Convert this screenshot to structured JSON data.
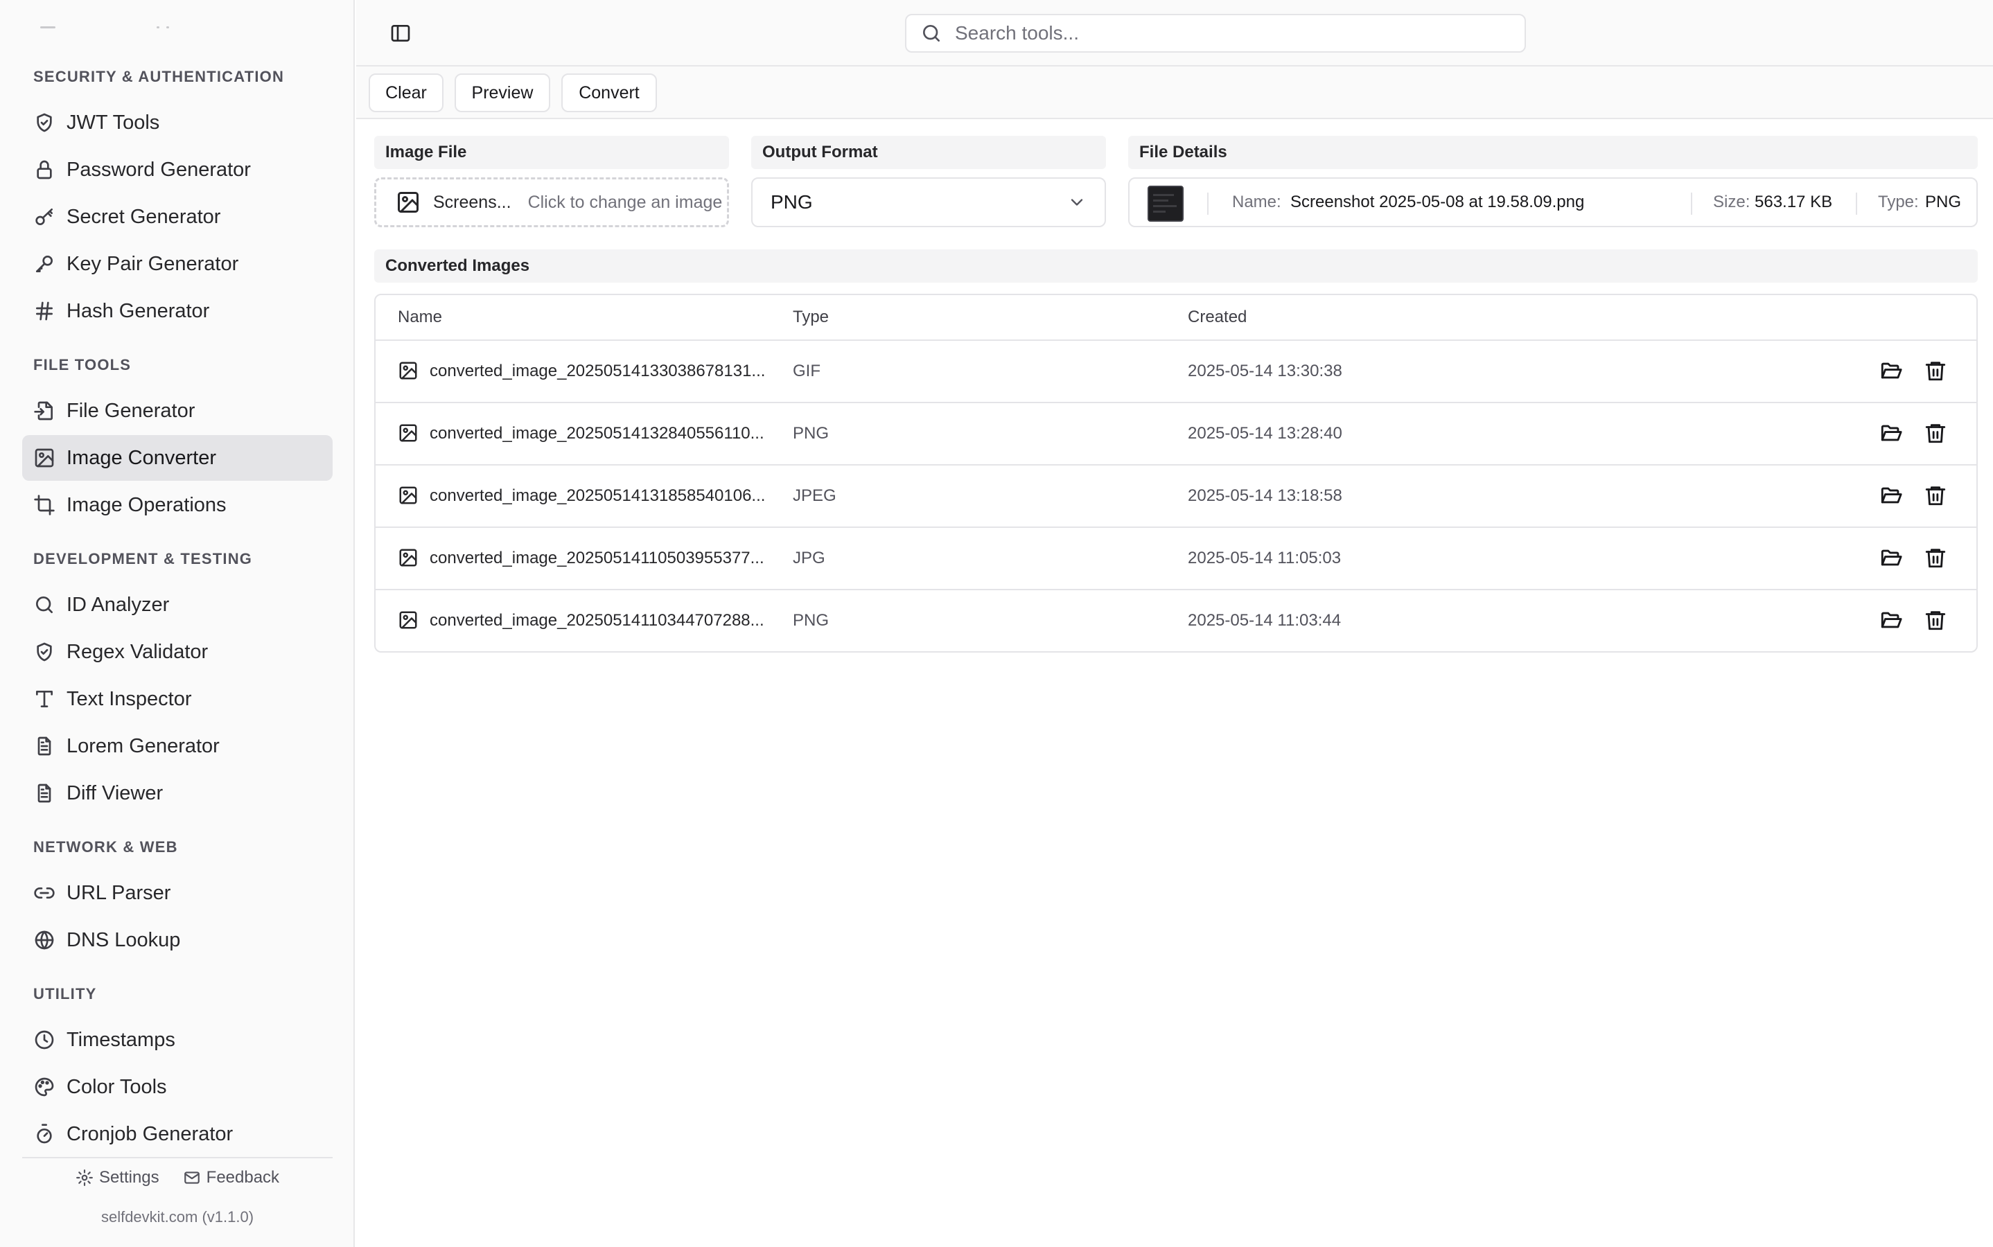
{
  "sidebar": {
    "sections": [
      {
        "title": "SECURITY & AUTHENTICATION",
        "items": [
          {
            "label": "JWT Tools",
            "icon": "shield-check-icon"
          },
          {
            "label": "Password Generator",
            "icon": "lock-icon"
          },
          {
            "label": "Secret Generator",
            "icon": "key-round-icon"
          },
          {
            "label": "Key Pair Generator",
            "icon": "key-icon"
          },
          {
            "label": "Hash Generator",
            "icon": "hash-icon"
          }
        ]
      },
      {
        "title": "FILE TOOLS",
        "items": [
          {
            "label": "File Generator",
            "icon": "file-input-icon"
          },
          {
            "label": "Image Converter",
            "icon": "image-icon",
            "active": true
          },
          {
            "label": "Image Operations",
            "icon": "crop-icon"
          }
        ]
      },
      {
        "title": "DEVELOPMENT & TESTING",
        "items": [
          {
            "label": "ID Analyzer",
            "icon": "search-icon"
          },
          {
            "label": "Regex Validator",
            "icon": "shield-check-icon"
          },
          {
            "label": "Text Inspector",
            "icon": "type-icon"
          },
          {
            "label": "Lorem Generator",
            "icon": "file-text-icon"
          },
          {
            "label": "Diff Viewer",
            "icon": "file-text-icon"
          }
        ]
      },
      {
        "title": "NETWORK & WEB",
        "items": [
          {
            "label": "URL Parser",
            "icon": "link-icon"
          },
          {
            "label": "DNS Lookup",
            "icon": "globe-icon"
          }
        ]
      },
      {
        "title": "UTILITY",
        "items": [
          {
            "label": "Timestamps",
            "icon": "clock-icon"
          },
          {
            "label": "Color Tools",
            "icon": "palette-icon"
          },
          {
            "label": "Cronjob Generator",
            "icon": "timer-icon"
          }
        ]
      }
    ],
    "footer": {
      "settings_label": "Settings",
      "feedback_label": "Feedback",
      "version": "selfdevkit.com (v1.1.0)"
    }
  },
  "search": {
    "placeholder": "Search tools..."
  },
  "toolbar": {
    "clear_label": "Clear",
    "preview_label": "Preview",
    "convert_label": "Convert"
  },
  "image_file": {
    "label": "Image File",
    "name": "Screens...",
    "hint": "Click to change an image"
  },
  "output_format": {
    "label": "Output Format",
    "value": "PNG"
  },
  "file_details": {
    "label": "File Details",
    "name_key": "Name:",
    "name": "Screenshot 2025-05-08 at 19.58.09.png",
    "size_key": "Size:",
    "size": "563.17 KB",
    "type_key": "Type:",
    "type": "PNG"
  },
  "converted": {
    "title": "Converted Images",
    "columns": [
      "Name",
      "Type",
      "Created"
    ],
    "rows": [
      {
        "name": "converted_image_20250514133038678131...",
        "type": "GIF",
        "created": "2025-05-14 13:30:38"
      },
      {
        "name": "converted_image_20250514132840556110...",
        "type": "PNG",
        "created": "2025-05-14 13:28:40"
      },
      {
        "name": "converted_image_20250514131858540106...",
        "type": "JPEG",
        "created": "2025-05-14 13:18:58"
      },
      {
        "name": "converted_image_20250514110503955377...",
        "type": "JPG",
        "created": "2025-05-14 11:05:03"
      },
      {
        "name": "converted_image_20250514110344707288...",
        "type": "PNG",
        "created": "2025-05-14 11:03:44"
      }
    ]
  }
}
